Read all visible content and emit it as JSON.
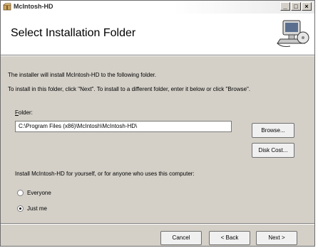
{
  "window": {
    "title": "McIntosh-HD",
    "controls": {
      "minimize": "_",
      "maximize": "□",
      "close": "×"
    }
  },
  "header": {
    "title": "Select Installation Folder"
  },
  "body": {
    "intro": "The installer will install McIntosh-HD to the following folder.",
    "instructions": "To install in this folder, click \"Next\". To install to a different folder, enter it below or click \"Browse\".",
    "folder_label_mnemonic": "F",
    "folder_label_rest": "older:",
    "folder_path": "C:\\Program Files (x86)\\McIntosh\\McIntosh-HD\\",
    "browse_label": "Browse...",
    "disk_cost_label": "Disk Cost...",
    "install_question": "Install McIntosh-HD for yourself, or for anyone who uses this computer:",
    "everyone_label": "Everyone",
    "justme_label": "Just me",
    "selected_option": "Just me"
  },
  "footer": {
    "cancel_label": "Cancel",
    "back_label": "< Back",
    "next_label": "Next >"
  },
  "icons": {
    "app": "installer-box-icon",
    "header": "computer-disk-icon"
  }
}
